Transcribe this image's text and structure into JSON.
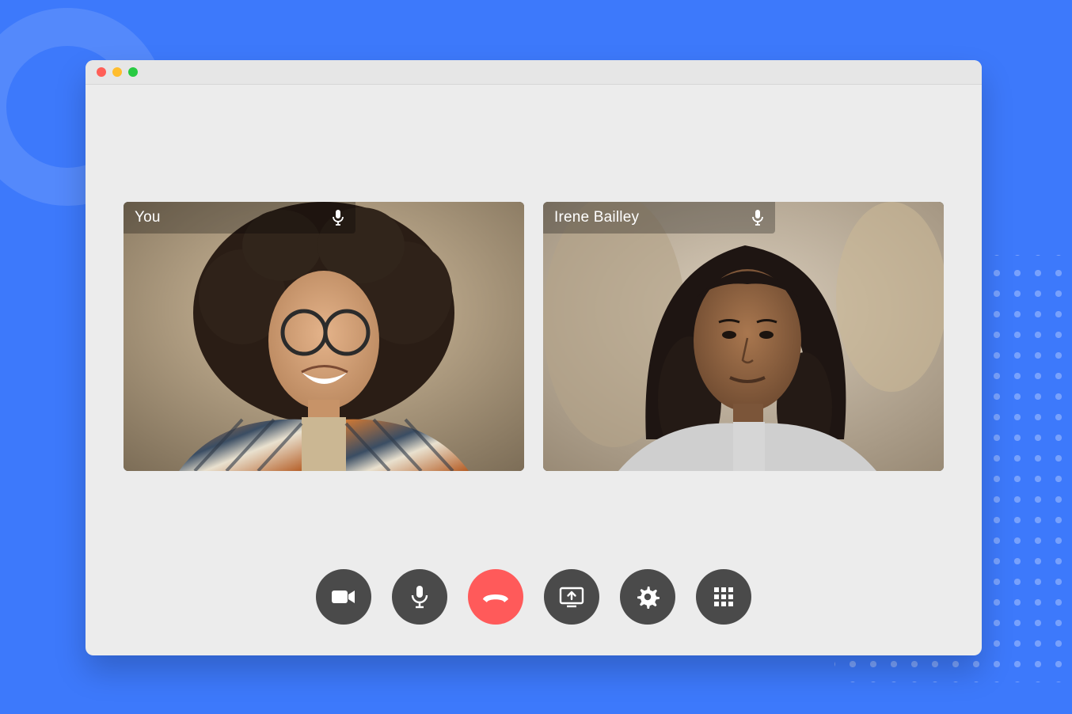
{
  "participants": [
    {
      "label": "You"
    },
    {
      "label": "Irene Bailley"
    }
  ],
  "colors": {
    "background_blue": "#3d79fb",
    "window_bg": "#ececec",
    "control_button_bg": "#4a4a4a",
    "hangup_bg": "#ff5a5a",
    "icon_white": "#ffffff"
  },
  "controls": [
    {
      "name": "camera",
      "tooltip": "Toggle camera"
    },
    {
      "name": "microphone",
      "tooltip": "Toggle microphone"
    },
    {
      "name": "hangup",
      "tooltip": "End call"
    },
    {
      "name": "share-screen",
      "tooltip": "Share screen"
    },
    {
      "name": "settings",
      "tooltip": "Settings"
    },
    {
      "name": "dialpad",
      "tooltip": "Grid / dialpad"
    }
  ]
}
